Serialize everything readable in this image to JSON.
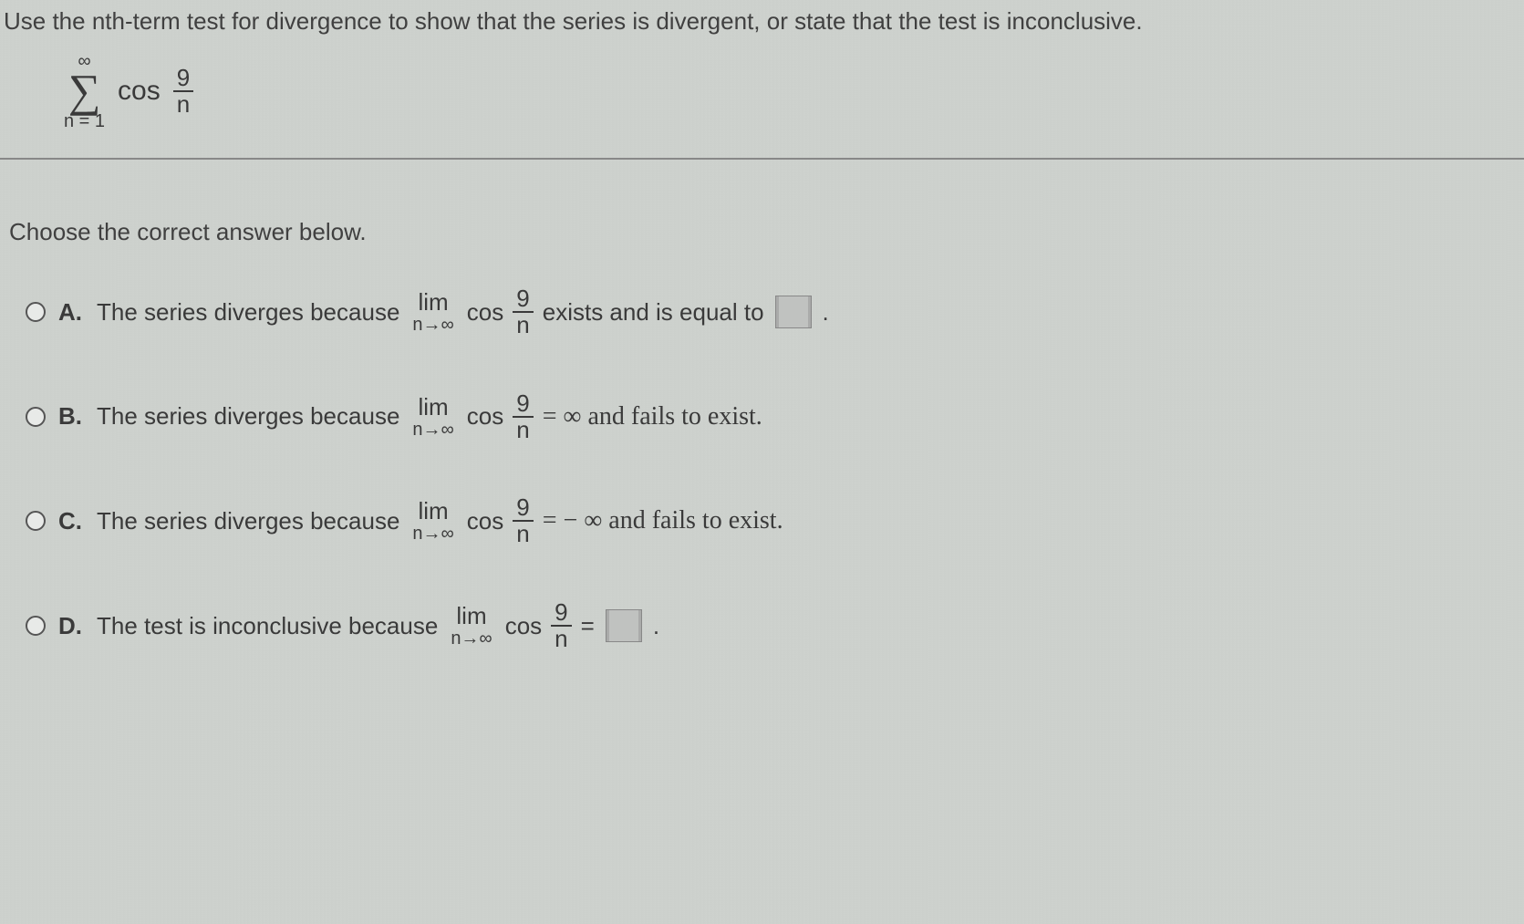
{
  "question": "Use the nth-term test for divergence to show that the series is divergent, or state that the test is inconclusive.",
  "series": {
    "upper": "∞",
    "lower": "n = 1",
    "func": "cos",
    "frac_num": "9",
    "frac_den": "n"
  },
  "prompt": "Choose the correct answer below.",
  "options": {
    "A": {
      "letter": "A.",
      "pre": "The series diverges because",
      "lim": "lim",
      "limsub": "n→∞",
      "func": "cos",
      "frac_num": "9",
      "frac_den": "n",
      "post1": "exists and is equal to",
      "period": "."
    },
    "B": {
      "letter": "B.",
      "pre": "The series diverges because",
      "lim": "lim",
      "limsub": "n→∞",
      "func": "cos",
      "frac_num": "9",
      "frac_den": "n",
      "eq": "= ∞ and fails to exist."
    },
    "C": {
      "letter": "C.",
      "pre": "The series diverges because",
      "lim": "lim",
      "limsub": "n→∞",
      "func": "cos",
      "frac_num": "9",
      "frac_den": "n",
      "eq": "= − ∞ and fails to exist."
    },
    "D": {
      "letter": "D.",
      "pre": "The test is inconclusive because",
      "lim": "lim",
      "limsub": "n→∞",
      "func": "cos",
      "frac_num": "9",
      "frac_den": "n",
      "eq": "=",
      "period": "."
    }
  }
}
